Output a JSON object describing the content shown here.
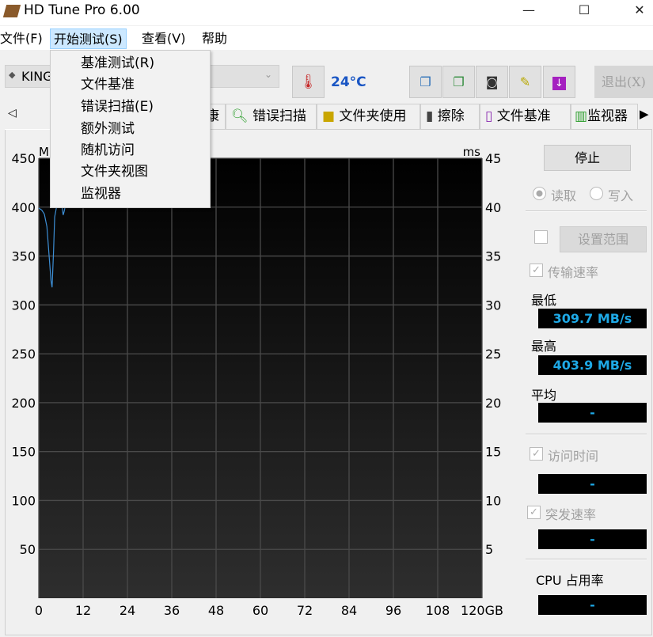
{
  "window": {
    "title": "HD Tune Pro 6.00",
    "minimize": "—",
    "maximize": "☐",
    "close": "✕"
  },
  "menu": {
    "items": [
      "文件(F)",
      "开始测试(S)",
      "查看(V)",
      "帮助"
    ],
    "active": 1,
    "dropdown": [
      "基准测试(R)",
      "文件基准",
      "错误扫描(E)",
      "额外测试",
      "随机访问",
      "文件夹视图",
      "监视器"
    ]
  },
  "toolbar": {
    "drive": "KING",
    "temperature": "24°C",
    "exit": "退出(X)",
    "temp_color": "#1a56c4"
  },
  "tabs": [
    "康",
    "错误扫描",
    "文件夹使用",
    "擦除",
    "文件基准",
    "监视器"
  ],
  "side": {
    "stop": "停止",
    "read": "读取",
    "write": "写入",
    "set_range": "设置范围",
    "transfer_rate": "传输速率",
    "min_label": "最低",
    "min_value": "309.7 MB/s",
    "max_label": "最高",
    "max_value": "403.9 MB/s",
    "avg_label": "平均",
    "avg_value": "-",
    "access_time": "访问时间",
    "access_value": "-",
    "burst_rate": "突发速率",
    "burst_value": "-",
    "cpu_label": "CPU 占用率",
    "cpu_value": "-"
  },
  "chart_data": {
    "type": "line",
    "left_unit": "MB/s",
    "right_unit": "ms",
    "x_ticks": [
      "0",
      "12",
      "24",
      "36",
      "48",
      "60",
      "72",
      "84",
      "96",
      "108",
      "120GB"
    ],
    "y_left_ticks": [
      "50",
      "100",
      "150",
      "200",
      "250",
      "300",
      "350",
      "400",
      "450"
    ],
    "y_right_ticks": [
      "5",
      "10",
      "15",
      "20",
      "25",
      "30",
      "35",
      "40",
      "45"
    ],
    "xlim": [
      0,
      120
    ],
    "ylim": [
      0,
      450
    ],
    "grid": true,
    "line_color": "#3d8fd6",
    "series": [
      {
        "segments": [
          [
            [
              0,
              399
            ],
            [
              0.8,
              397
            ],
            [
              1.5,
              393
            ],
            [
              2.2,
              380
            ],
            [
              2.8,
              350
            ],
            [
              3.3,
              325
            ],
            [
              3.6,
              318
            ],
            [
              4.0,
              355
            ],
            [
              4.3,
              390
            ],
            [
              4.8,
              400
            ]
          ],
          [
            [
              6.3,
              400
            ],
            [
              6.6,
              392
            ],
            [
              6.9,
              396
            ],
            [
              7.1,
              400
            ]
          ]
        ]
      }
    ]
  }
}
